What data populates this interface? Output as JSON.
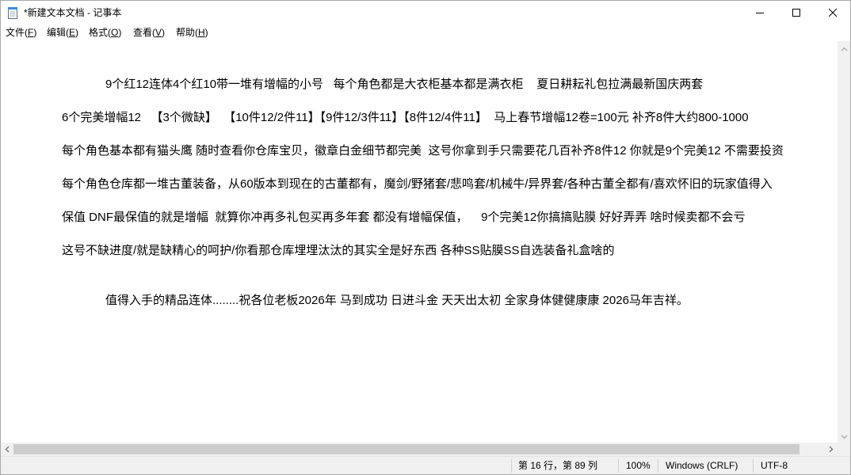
{
  "window": {
    "title": "*新建文本文档 - 记事本",
    "app_icon": "notepad-icon",
    "controls": {
      "minimize_icon": "minimize-icon",
      "maximize_icon": "maximize-icon",
      "close_icon": "close-icon"
    }
  },
  "menu": {
    "items": [
      {
        "label": "文件(F)"
      },
      {
        "label": "编辑(E)"
      },
      {
        "label": "格式(O)"
      },
      {
        "label": "查看(V)"
      },
      {
        "label": "帮助(H)"
      }
    ]
  },
  "editor": {
    "lines": [
      "",
      "",
      "9个红12连体4个红10带一堆有增幅的小号   每个角色都是大衣柜基本都是满衣柜    夏日耕耘礼包拉满最新国庆两套",
      "",
      "6个完美增幅12   【3个微缺】  【10件12/2件11】【9件12/3件11】【8件12/4件11】  马上春节增幅12卷=100元 补齐8件大约800-1000",
      "",
      "每个角色基本都有猫头鹰 随时查看你仓库宝贝，徽章白金细节都完美  这号你拿到手只需要花几百补齐8件12 你就是9个完美12 不需要投资",
      "",
      "每个角色仓库都一堆古董装备，从60版本到现在的古董都有，魔剑/野猪套/悲鸣套/机械牛/异界套/各种古董全都有/喜欢怀旧的玩家值得入",
      "",
      "保值 DNF最保值的就是增幅  就算你冲再多礼包买再多年套 都没有增幅保值，    9个完美12你搞搞贴膜 好好弄弄 啥时候卖都不会亏",
      "",
      "这号不缺进度/就是缺精心的呵护/你看那仓库埋埋汰汰的其实全是好东西 各种SS贴膜SS自选装备礼盒啥的",
      "",
      "",
      "值得入手的精品连体........祝各位老板2026年 马到成功 日进斗金 天天出太初 全家身体健健康康 2026马年吉祥。"
    ]
  },
  "scrollbars": {
    "horizontal": {
      "offset_fraction": 0,
      "visible_fraction": 0.97,
      "icons": [
        "chevron-left-icon",
        "chevron-right-icon"
      ]
    },
    "vertical": {
      "enabled": false,
      "icons": [
        "chevron-up-icon",
        "chevron-down-icon"
      ]
    }
  },
  "status_bar": {
    "cursor_position": "第 16 行，第 89 列",
    "zoom": "100%",
    "line_ending": "Windows (CRLF)",
    "encoding": "UTF-8"
  },
  "colors": {
    "chrome": "#f0f0f0",
    "scroll_thumb": "#cdcdcd",
    "text": "#000000"
  }
}
